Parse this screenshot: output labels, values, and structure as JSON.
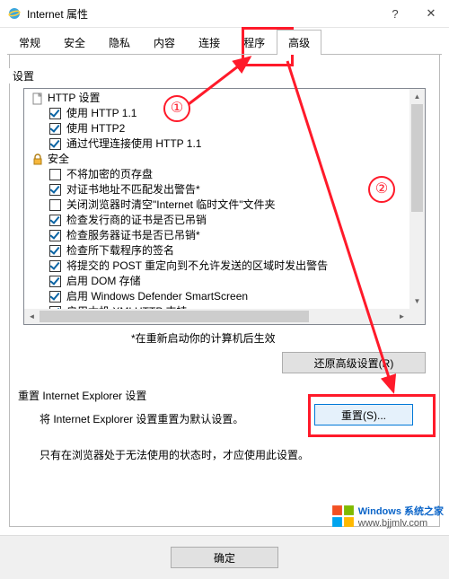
{
  "window": {
    "title": "Internet 属性"
  },
  "titlebar": {
    "help_glyph": "?",
    "close_glyph": "✕"
  },
  "tabs": {
    "items": [
      "常规",
      "安全",
      "隐私",
      "内容",
      "连接",
      "程序",
      "高级"
    ],
    "active_index": 6
  },
  "settings": {
    "group_label": "设置",
    "tree": [
      {
        "type": "node",
        "icon": "page",
        "label": "HTTP 设置"
      },
      {
        "type": "check",
        "checked": true,
        "label": "使用 HTTP 1.1"
      },
      {
        "type": "check",
        "checked": true,
        "label": "使用 HTTP2"
      },
      {
        "type": "check",
        "checked": true,
        "label": "通过代理连接使用 HTTP 1.1"
      },
      {
        "type": "node",
        "icon": "lock",
        "label": "安全"
      },
      {
        "type": "check",
        "checked": false,
        "label": "不将加密的页存盘"
      },
      {
        "type": "check",
        "checked": true,
        "label": "对证书地址不匹配发出警告*"
      },
      {
        "type": "check",
        "checked": false,
        "label": "关闭浏览器时清空\"Internet 临时文件\"文件夹"
      },
      {
        "type": "check",
        "checked": true,
        "label": "检查发行商的证书是否已吊销"
      },
      {
        "type": "check",
        "checked": true,
        "label": "检查服务器证书是否已吊销*"
      },
      {
        "type": "check",
        "checked": true,
        "label": "检查所下载程序的签名"
      },
      {
        "type": "check",
        "checked": true,
        "label": "将提交的 POST 重定向到不允许发送的区域时发出警告"
      },
      {
        "type": "check",
        "checked": true,
        "label": "启用 DOM 存储"
      },
      {
        "type": "check",
        "checked": true,
        "label": "启用 Windows Defender SmartScreen"
      },
      {
        "type": "check",
        "checked": true,
        "label": "启用本机 XMLHTTP 支持"
      }
    ],
    "note": "*在重新启动你的计算机后生效",
    "restore_button": "还原高级设置(R)"
  },
  "reset": {
    "group_label": "重置 Internet Explorer 设置",
    "desc": "将 Internet Explorer 设置重置为默认设置。",
    "button": "重置(S)...",
    "note": "只有在浏览器处于无法使用的状态时，才应使用此设置。"
  },
  "buttons": {
    "ok": "确定"
  },
  "annotations": {
    "circle1": "①",
    "circle2": "②"
  },
  "watermark": {
    "line1": "Windows 系统之家",
    "line2": "www.bjjmlv.com"
  }
}
